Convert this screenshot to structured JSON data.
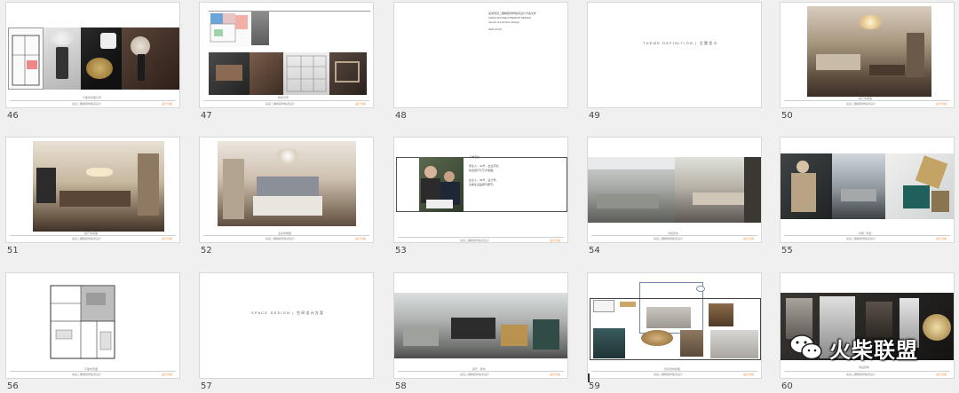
{
  "slides": [
    {
      "number": "46",
      "caption": "平面布置图示意"
    },
    {
      "number": "47",
      "caption": "柜体示意"
    },
    {
      "number": "48",
      "caption": ""
    },
    {
      "number": "49",
      "caption": ""
    },
    {
      "number": "50",
      "caption": "客厅效果图"
    },
    {
      "number": "51",
      "caption": "餐厅效果图"
    },
    {
      "number": "52",
      "caption": "主卧效果图"
    },
    {
      "number": "53",
      "caption": "人物定位"
    },
    {
      "number": "54",
      "caption": "风格意向"
    },
    {
      "number": "55",
      "caption": "材质 / 软装"
    },
    {
      "number": "56",
      "caption": "平面布置图"
    },
    {
      "number": "57",
      "caption": ""
    },
    {
      "number": "58",
      "caption": "客厅 · 意向"
    },
    {
      "number": "59",
      "caption": "家具意向拼图"
    },
    {
      "number": "60",
      "caption": "饰品意向"
    }
  ],
  "footer_text": "某某二期精装样板间设计",
  "footer_mark": "设计方案",
  "slide49_title": "THEME  DEFINITION  |  主题定义",
  "slide57_title": "SPACE  DESIGN  |  空间设计方案",
  "slide48_lines": [
    "某某项目二期精装修样板间设计方案文件",
    "CHINA HOUSE INTERIOR DESIGN",
    "Interior & Furniture Design",
    "2021.03.02"
  ],
  "slide53_lines": [
    "男主人，40岁，企业高管，",
    "热爱旅行与艺术收藏。",
    "女主人，38岁，设计师，",
    "注重生活品质与细节。"
  ],
  "watermark_text": "火柴联盟"
}
